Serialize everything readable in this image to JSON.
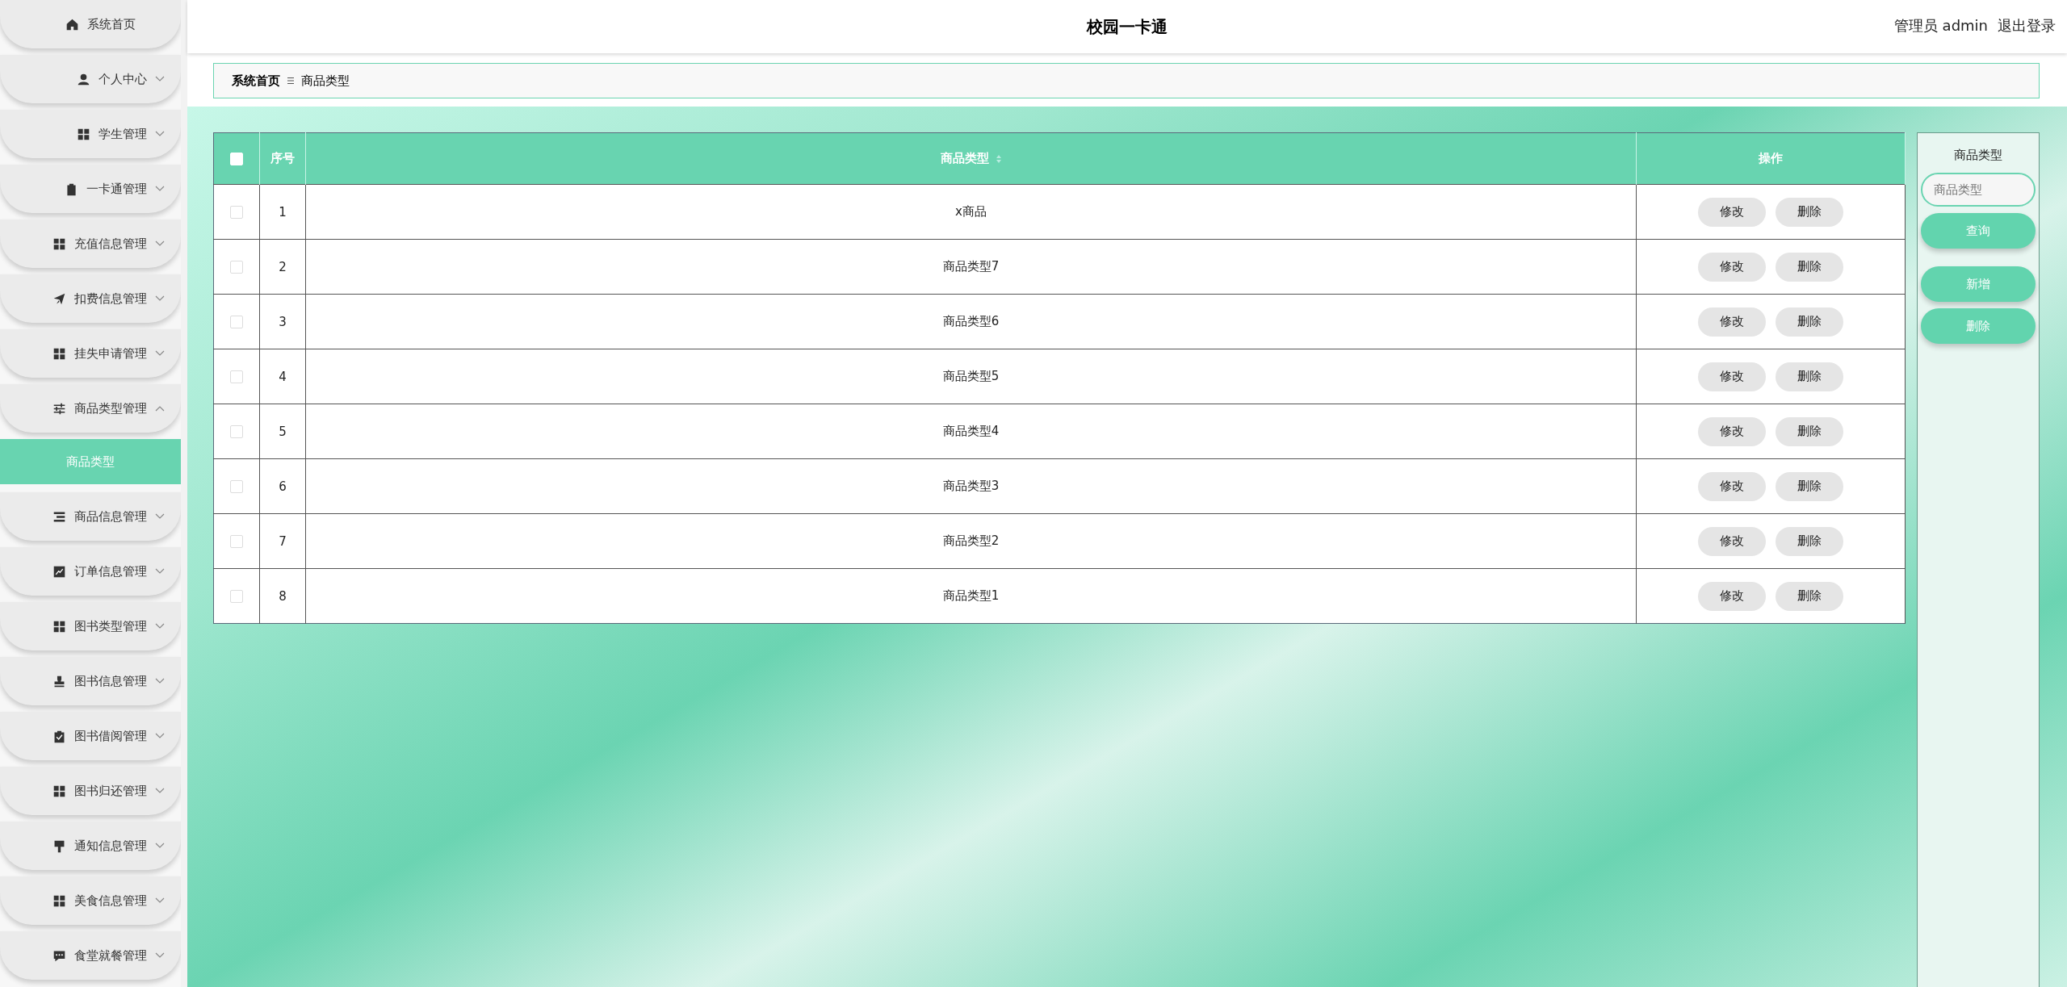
{
  "sidebar": {
    "items": [
      {
        "label": "系统首页",
        "kind": "link"
      },
      {
        "label": "个人中心",
        "kind": "menu",
        "expanded": false
      },
      {
        "label": "学生管理",
        "kind": "menu",
        "expanded": false
      },
      {
        "label": "一卡通管理",
        "kind": "menu",
        "expanded": false
      },
      {
        "label": "充值信息管理",
        "kind": "menu",
        "expanded": false
      },
      {
        "label": "扣费信息管理",
        "kind": "menu",
        "expanded": false
      },
      {
        "label": "挂失申请管理",
        "kind": "menu",
        "expanded": false
      },
      {
        "label": "商品类型管理",
        "kind": "menu",
        "expanded": true,
        "children": [
          {
            "label": "商品类型",
            "selected": true
          }
        ]
      },
      {
        "label": "商品信息管理",
        "kind": "menu",
        "expanded": false
      },
      {
        "label": "订单信息管理",
        "kind": "menu",
        "expanded": false
      },
      {
        "label": "图书类型管理",
        "kind": "menu",
        "expanded": false
      },
      {
        "label": "图书信息管理",
        "kind": "menu",
        "expanded": false
      },
      {
        "label": "图书借阅管理",
        "kind": "menu",
        "expanded": false
      },
      {
        "label": "图书归还管理",
        "kind": "menu",
        "expanded": false
      },
      {
        "label": "通知信息管理",
        "kind": "menu",
        "expanded": false
      },
      {
        "label": "美食信息管理",
        "kind": "menu",
        "expanded": false
      },
      {
        "label": "食堂就餐管理",
        "kind": "menu",
        "expanded": false
      }
    ]
  },
  "header": {
    "title": "校园一卡通",
    "user": "管理员 admin",
    "logout": "退出登录"
  },
  "breadcrumb": [
    "系统首页",
    "商品类型"
  ],
  "table": {
    "header_checked": false,
    "columns": [
      "序号",
      "商品类型",
      "操作"
    ],
    "rows": [
      {
        "checked": false,
        "index": "1",
        "type": "x商品",
        "actions": [
          "修改",
          "删除"
        ]
      },
      {
        "checked": false,
        "index": "2",
        "type": "商品类型7",
        "actions": [
          "修改",
          "删除"
        ]
      },
      {
        "checked": false,
        "index": "3",
        "type": "商品类型6",
        "actions": [
          "修改",
          "删除"
        ]
      },
      {
        "checked": false,
        "index": "4",
        "type": "商品类型5",
        "actions": [
          "修改",
          "删除"
        ]
      },
      {
        "checked": false,
        "index": "5",
        "type": "商品类型4",
        "actions": [
          "修改",
          "删除"
        ]
      },
      {
        "checked": false,
        "index": "6",
        "type": "商品类型3",
        "actions": [
          "修改",
          "删除"
        ]
      },
      {
        "checked": false,
        "index": "7",
        "type": "商品类型2",
        "actions": [
          "修改",
          "删除"
        ]
      },
      {
        "checked": false,
        "index": "8",
        "type": "商品类型1",
        "actions": [
          "修改",
          "删除"
        ]
      }
    ]
  },
  "search_panel": {
    "label": "商品类型",
    "placeholder": "商品类型",
    "buttons": [
      "查询",
      "新增",
      "删除"
    ]
  }
}
